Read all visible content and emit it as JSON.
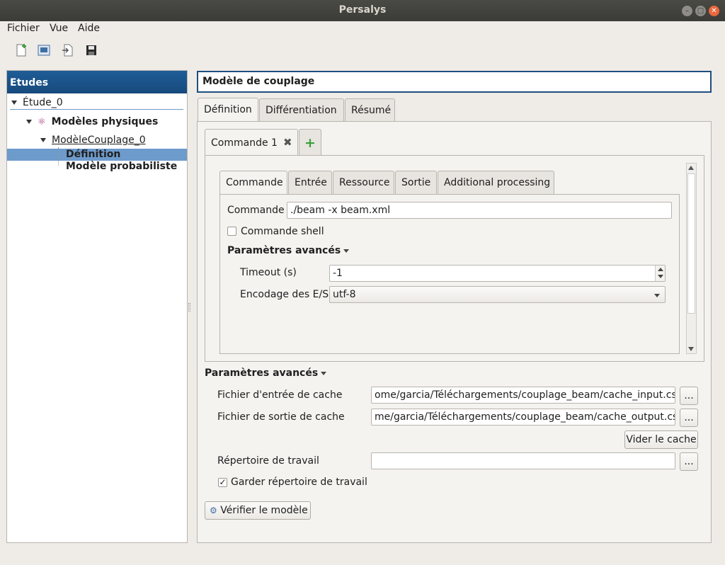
{
  "window": {
    "title": "Persalys"
  },
  "menubar": {
    "items": [
      {
        "label": "Fichier"
      },
      {
        "label": "Vue"
      },
      {
        "label": "Aide"
      }
    ]
  },
  "toolbar": {
    "icons": [
      "new-study-icon",
      "open-study-icon",
      "import-icon",
      "save-icon"
    ]
  },
  "left_panel": {
    "header": "Etudes",
    "tree": [
      {
        "label": "Étude_0"
      },
      {
        "label": "Modèles physiques"
      },
      {
        "label": "ModèleCouplage_0"
      },
      {
        "label": "Définition"
      },
      {
        "label": "Modèle probabiliste"
      }
    ]
  },
  "main": {
    "title": "Modèle de couplage",
    "tabs": [
      {
        "label": "Définition"
      },
      {
        "label": "Différentiation"
      },
      {
        "label": "Résumé"
      }
    ],
    "command_tabs": [
      {
        "label": "Commande 1"
      }
    ],
    "inner_tabs": [
      {
        "label": "Commande"
      },
      {
        "label": "Entrée"
      },
      {
        "label": "Ressource"
      },
      {
        "label": "Sortie"
      },
      {
        "label": "Additional processing"
      }
    ],
    "command_label": "Commande",
    "command_value": "./beam -x beam.xml",
    "shell_label": "Commande shell",
    "shell_checked": false,
    "inner_advanced_label": "Paramètres avancés",
    "timeout_label": "Timeout (s)",
    "timeout_value": "-1",
    "encoding_label": "Encodage des E/S",
    "encoding_value": "utf-8",
    "advanced_label": "Paramètres avancés",
    "cache_in_label": "Fichier d'entrée de cache",
    "cache_in_value": "ome/garcia/Téléchargements/couplage_beam/cache_input.csv",
    "cache_out_label": "Fichier de sortie de cache",
    "cache_out_value": "me/garcia/Téléchargements/couplage_beam/cache_output.csv",
    "browse_label": "...",
    "clear_cache_label": "Vider le cache",
    "workdir_label": "Répertoire de travail",
    "workdir_value": "",
    "keep_workdir_label": "Garder répertoire de travail",
    "keep_workdir_checked": true,
    "verify_label": "Vérifier le modèle"
  },
  "colors": {
    "header_blue": "#1f5c97",
    "selection_blue": "#6d9bcb",
    "window_bg": "#efebe7",
    "close_orange": "#e9683d",
    "add_green": "#3aa03a"
  }
}
